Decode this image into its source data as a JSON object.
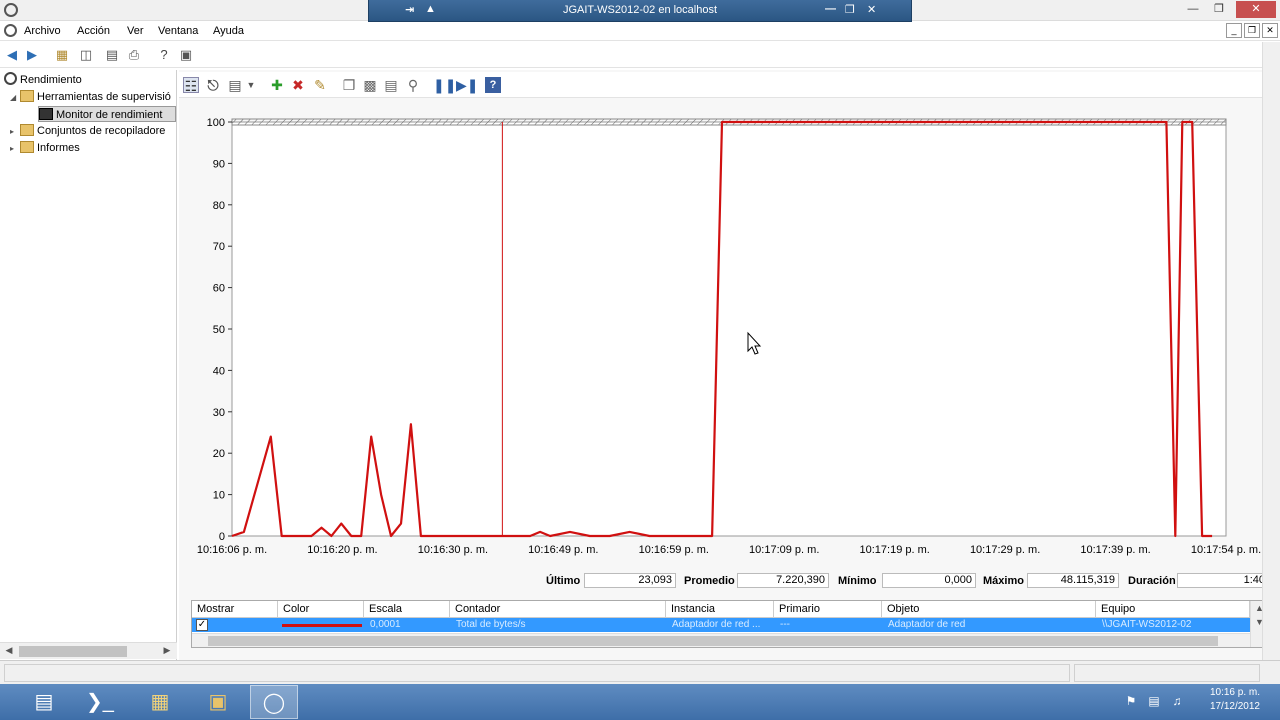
{
  "remote_bar": {
    "title": "JGAIT-WS2012-02 en localhost"
  },
  "menu": {
    "items": [
      "Archivo",
      "Acción",
      "Ver",
      "Ventana",
      "Ayuda"
    ]
  },
  "tree": {
    "root": "Rendimiento",
    "tools": "Herramientas de supervisió",
    "monitor": "Monitor de rendimient",
    "collector_sets": "Conjuntos de recopiladore",
    "reports": "Informes"
  },
  "colors": {
    "series": "#d01010",
    "selection": "#3399ff",
    "taskbar": "#4a7ab4"
  },
  "chart_data": {
    "type": "line",
    "title": "",
    "xlabel": "",
    "ylabel": "",
    "ylim": [
      0,
      100
    ],
    "y_ticks": [
      "0",
      "10",
      "20",
      "30",
      "40",
      "50",
      "60",
      "70",
      "80",
      "90",
      "100"
    ],
    "x_tick_labels": [
      "10:16:06 p. m.",
      "10:16:20 p. m.",
      "10:16:30 p. m.",
      "10:16:49 p. m.",
      "10:16:59 p. m.",
      "10:17:09 p. m.",
      "10:17:19 p. m.",
      "10:17:29 p. m.",
      "10:17:39 p. m.",
      "10:17:54 p. m."
    ],
    "x_range": [
      0,
      100
    ],
    "current_position": 27.2,
    "series": [
      {
        "x": [
          0,
          1.2,
          3.9,
          5.0,
          8.0,
          9.0,
          10.0,
          11.0,
          12.0,
          13.0,
          14.0,
          15.0,
          16.0,
          17.0,
          18.0,
          19.0,
          20.0,
          21.0,
          27.2,
          30.0,
          31.0,
          32.0,
          34.0,
          36.0,
          37.0,
          38.0,
          40.0,
          42.0,
          44.0,
          48.3,
          49.3,
          94.0,
          94.9,
          95.6,
          96.6,
          97.6,
          98.6
        ],
        "y": [
          0,
          1,
          24,
          0,
          0,
          2,
          0,
          3,
          0,
          0,
          24,
          10,
          0,
          3,
          27,
          0,
          0,
          0,
          0,
          0,
          1,
          0,
          1,
          0,
          0,
          0,
          1,
          0,
          0,
          0,
          100,
          100,
          0,
          100,
          100,
          0,
          0
        ]
      }
    ]
  },
  "stats": {
    "last_label": "Último",
    "last_value": "23,093",
    "avg_label": "Promedio",
    "avg_value": "7.220,390",
    "min_label": "Mínimo",
    "min_value": "0,000",
    "max_label": "Máximo",
    "max_value": "48.115,319",
    "dur_label": "Duración",
    "dur_value": "1:40"
  },
  "counter_table": {
    "headers": [
      "Mostrar",
      "Color",
      "Escala",
      "Contador",
      "Instancia",
      "Primario",
      "Objeto",
      "Equipo"
    ],
    "row": {
      "show": "✓",
      "scale": "0,0001",
      "counter": "Total de bytes/s",
      "instance": "Adaptador de red ...",
      "parent": "---",
      "object": "Adaptador de red",
      "computer": "\\\\JGAIT-WS2012-02"
    }
  },
  "taskbar": {
    "clock_time": "10:16 p. m.",
    "clock_date": "17/12/2012"
  }
}
